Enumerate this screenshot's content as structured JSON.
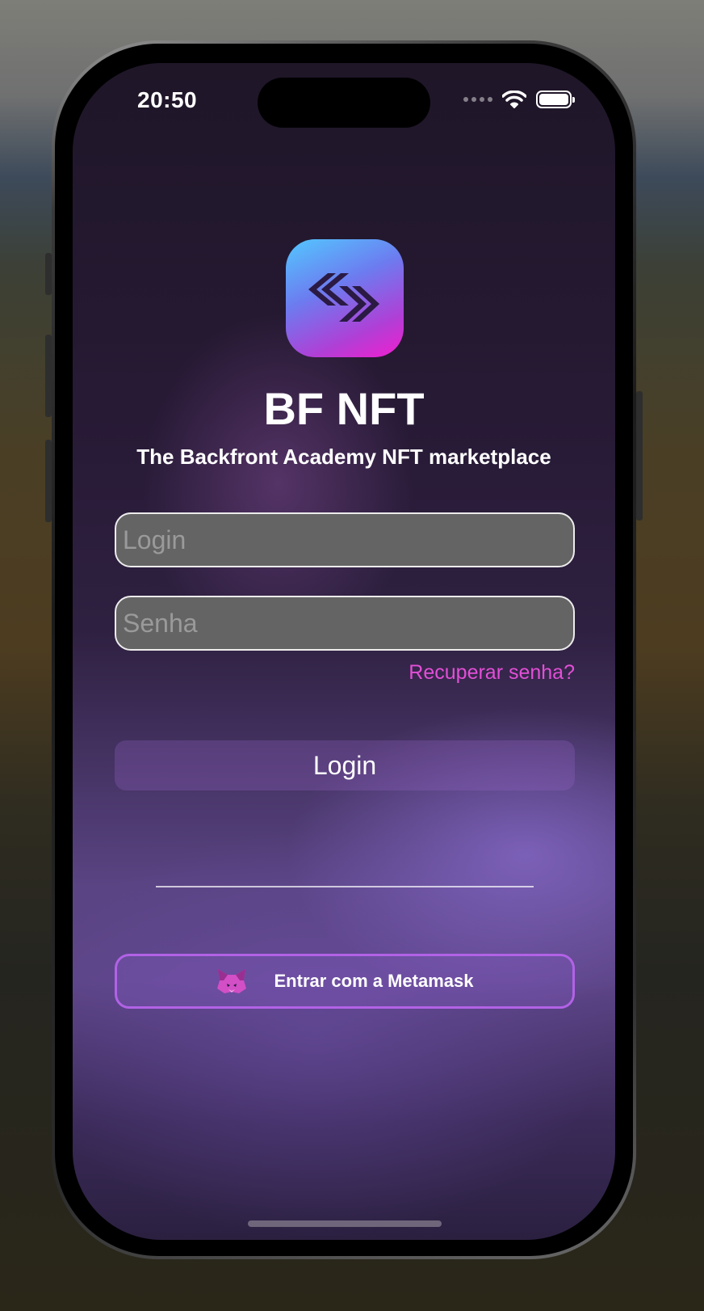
{
  "status_bar": {
    "time": "20:50"
  },
  "app": {
    "title": "BF NFT",
    "subtitle": "The Backfront Academy NFT marketplace"
  },
  "form": {
    "login_placeholder": "Login",
    "login_value": "",
    "password_placeholder": "Senha",
    "password_value": "",
    "forgot_password": "Recuperar senha?",
    "login_button": "Login",
    "metamask_button": "Entrar com a Metamask"
  },
  "icons": {
    "app_logo": "chevrons-logo-icon",
    "metamask": "metamask-fox-icon",
    "wifi": "wifi-icon",
    "battery": "battery-icon",
    "signal": "signal-icon"
  },
  "colors": {
    "accent_pink": "#e24fd6",
    "metamask_border": "#b262e6",
    "logo_gradient_start": "#53c8ff",
    "logo_gradient_end": "#f21ecf"
  }
}
